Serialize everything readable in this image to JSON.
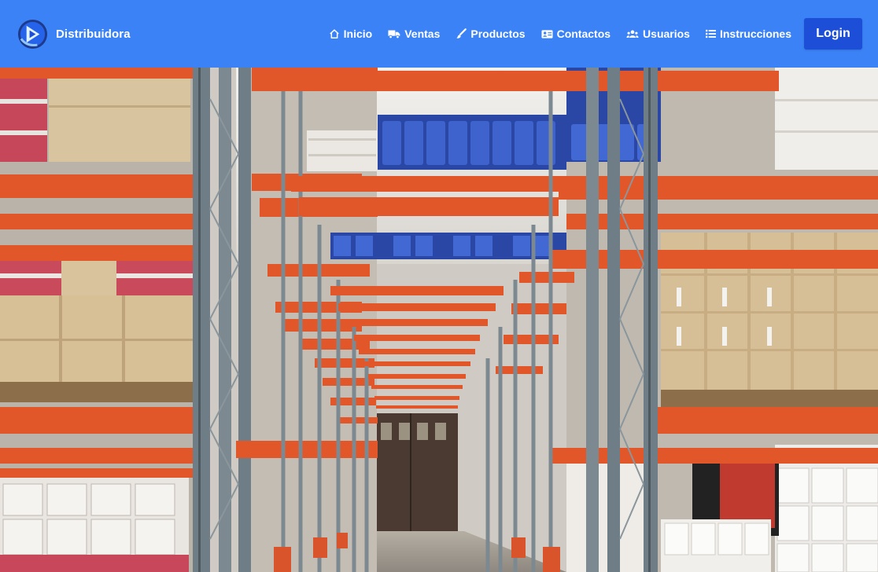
{
  "header": {
    "brand": "Distribuidora",
    "nav": [
      {
        "label": "Inicio",
        "icon": "home-icon"
      },
      {
        "label": "Ventas",
        "icon": "truck-icon"
      },
      {
        "label": "Productos",
        "icon": "brush-icon"
      },
      {
        "label": "Contactos",
        "icon": "address-card-icon"
      },
      {
        "label": "Usuarios",
        "icon": "users-icon"
      },
      {
        "label": "Instrucciones",
        "icon": "list-icon"
      }
    ],
    "login_label": "Login"
  },
  "colors": {
    "navbar": "#3b82f6",
    "login_button": "#1d4ed8",
    "shelf_orange": "#e2572a",
    "upright_gray": "#6f7d86"
  },
  "hero": {
    "image": "warehouse-aisle-photo"
  }
}
